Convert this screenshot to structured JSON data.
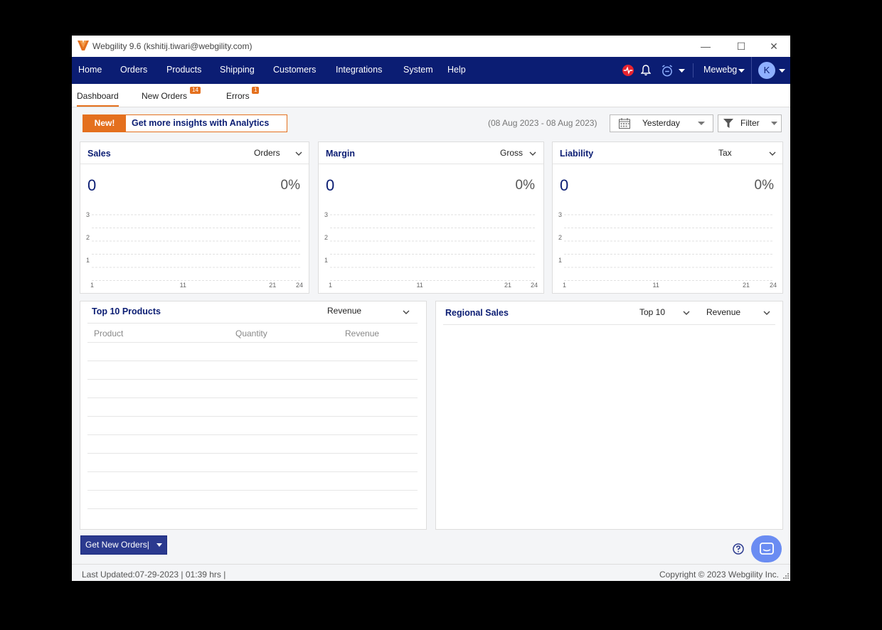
{
  "window": {
    "title": "Webgility 9.6 (kshitij.tiwari@webgility.com)",
    "minimize_glyph": "—",
    "maximize_glyph": "☐",
    "close_glyph": "✕"
  },
  "nav": {
    "items": [
      "Home",
      "Orders",
      "Products",
      "Shipping",
      "Customers",
      "Integrations",
      "System",
      "Help"
    ],
    "account": "Mewebg",
    "avatar_letter": "K"
  },
  "tabs": [
    {
      "label": "Dashboard",
      "badge": ""
    },
    {
      "label": "New Orders",
      "badge": "14"
    },
    {
      "label": "Errors",
      "badge": "1"
    }
  ],
  "promo": {
    "new_label": "New!",
    "text": "Get more insights with Analytics"
  },
  "date": {
    "range": "(08 Aug 2023 - 08 Aug 2023)",
    "selected": "Yesterday",
    "filter_label": "Filter"
  },
  "cards": [
    {
      "title": "Sales",
      "dropdown": "Orders",
      "value": "0",
      "percent": "0%"
    },
    {
      "title": "Margin",
      "dropdown": "Gross",
      "value": "0",
      "percent": "0%"
    },
    {
      "title": "Liability",
      "dropdown": "Tax",
      "value": "0",
      "percent": "0%"
    }
  ],
  "chart_data": [
    {
      "type": "line",
      "title": "Sales",
      "x_ticks": [
        "1",
        "11",
        "21",
        "24"
      ],
      "y_ticks": [
        "3",
        "2",
        "1"
      ],
      "series": []
    },
    {
      "type": "line",
      "title": "Margin",
      "x_ticks": [
        "1",
        "11",
        "21",
        "24"
      ],
      "y_ticks": [
        "3",
        "2",
        "1"
      ],
      "series": []
    },
    {
      "type": "line",
      "title": "Liability",
      "x_ticks": [
        "1",
        "11",
        "21",
        "24"
      ],
      "y_ticks": [
        "3",
        "2",
        "1"
      ],
      "series": []
    }
  ],
  "top_products": {
    "title": "Top 10 Products",
    "dropdown": "Revenue",
    "columns": [
      "Product",
      "Quantity",
      "Revenue"
    ],
    "rows": []
  },
  "regional": {
    "title": "Regional Sales",
    "dropdown1": "Top 10",
    "dropdown2": "Revenue"
  },
  "footer": {
    "get_orders_label": "Get New Orders|",
    "last_updated": "Last Updated:07-29-2023 | 01:39 hrs |",
    "copyright": "Copyright © 2023 Webgility Inc."
  },
  "colors": {
    "nav": "#0b1d73",
    "accent": "#e4701e",
    "primary_button": "#2b3a8f"
  }
}
